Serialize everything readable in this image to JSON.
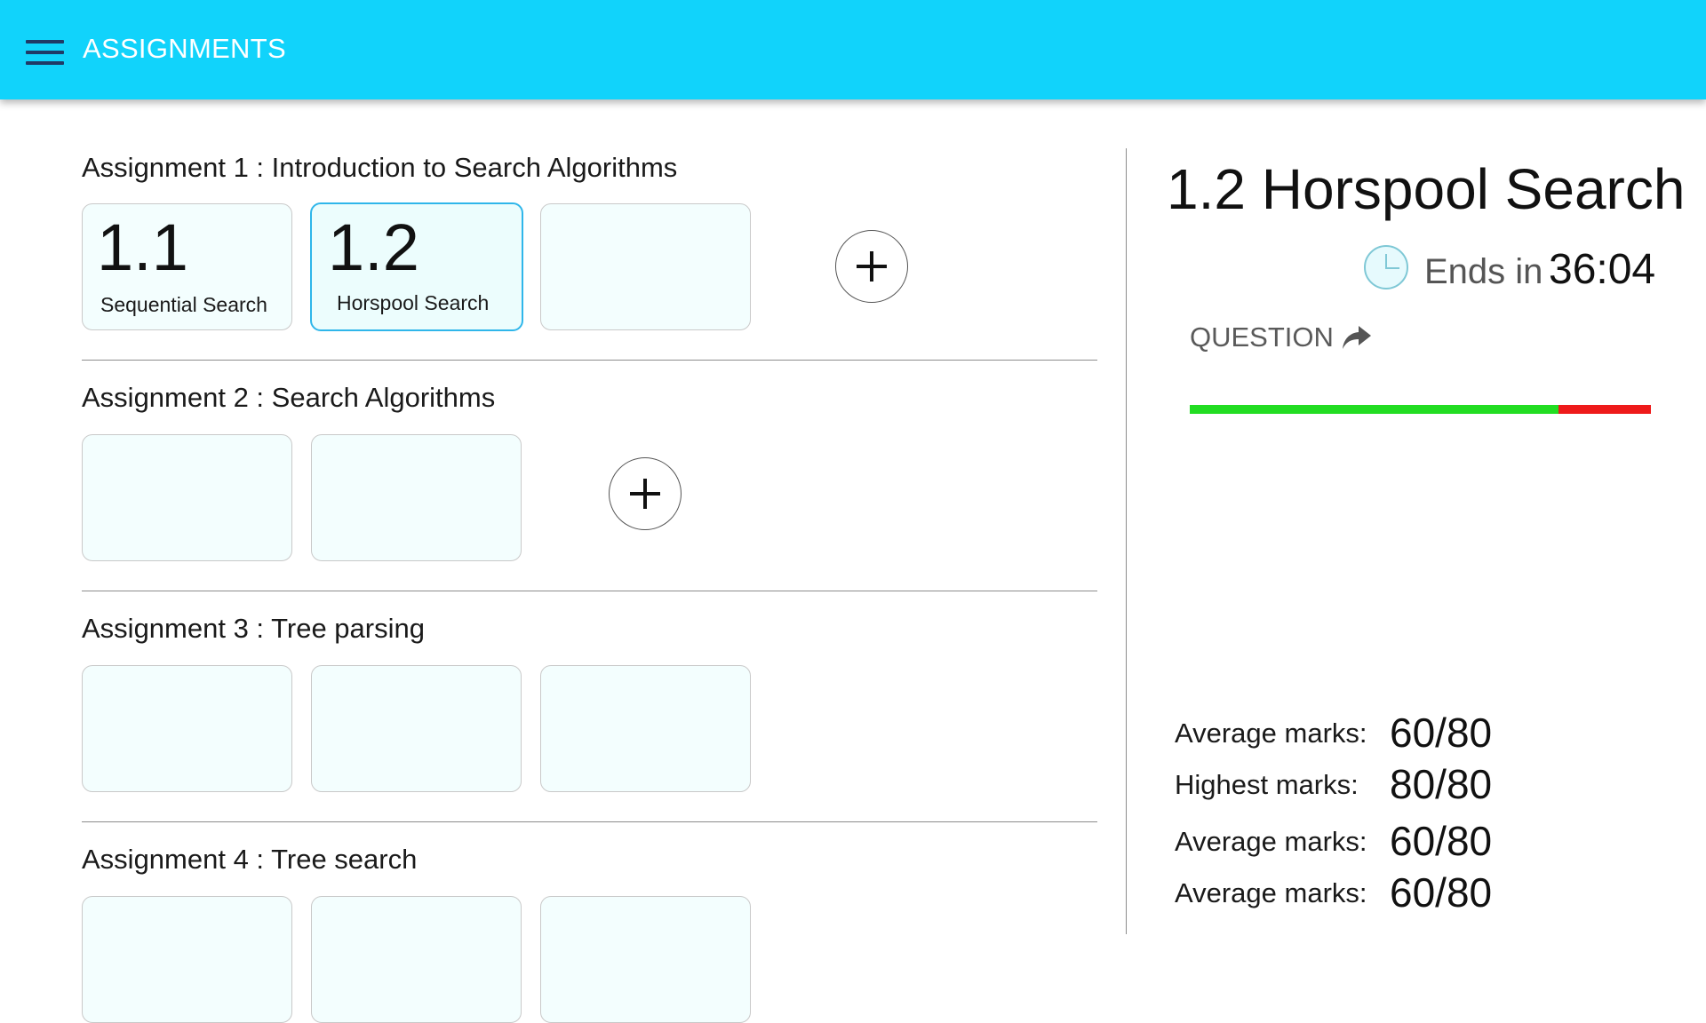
{
  "appbar": {
    "title": "ASSIGNMENTS",
    "menu_icon": "hamburger-menu-icon",
    "background": "#11d3fb"
  },
  "assignments": [
    {
      "title": "Assignment 1 : Introduction to Search Algorithms",
      "cards": [
        {
          "number": "1.1",
          "label": "Sequential Search",
          "selected": false
        },
        {
          "number": "1.2",
          "label": "Horspool Search",
          "selected": true
        },
        {
          "number": "",
          "label": "",
          "selected": false
        }
      ],
      "has_add_button": true
    },
    {
      "title": "Assignment 2 : Search Algorithms",
      "cards": [
        {
          "number": "",
          "label": "",
          "selected": false
        },
        {
          "number": "",
          "label": "",
          "selected": false
        }
      ],
      "has_add_button": true
    },
    {
      "title": "Assignment 3 : Tree parsing",
      "cards": [
        {
          "number": "",
          "label": "",
          "selected": false
        },
        {
          "number": "",
          "label": "",
          "selected": false
        },
        {
          "number": "",
          "label": "",
          "selected": false
        }
      ],
      "has_add_button": false
    },
    {
      "title": "Assignment 4 : Tree search",
      "cards": [
        {
          "number": "",
          "label": "",
          "selected": false
        },
        {
          "number": "",
          "label": "",
          "selected": false
        },
        {
          "number": "",
          "label": "",
          "selected": false
        }
      ],
      "has_add_button": false
    }
  ],
  "detail": {
    "title": "1.2 Horspool Search",
    "clock_icon": "clock-icon",
    "ends_label": "Ends in",
    "ends_time": "36:04",
    "question_label": "QUESTION",
    "question_icon": "share-arrow-icon",
    "progress_fraction": 0.8,
    "progress_colors": {
      "done": "#22dd22",
      "remaining": "#ee1a1a"
    },
    "stats": [
      {
        "label": "Average marks:",
        "value": "60/80"
      },
      {
        "label": "Highest marks:",
        "value": "80/80"
      },
      {
        "label": "Average marks:",
        "value": "60/80"
      },
      {
        "label": "Average marks:",
        "value": "60/80"
      }
    ]
  }
}
